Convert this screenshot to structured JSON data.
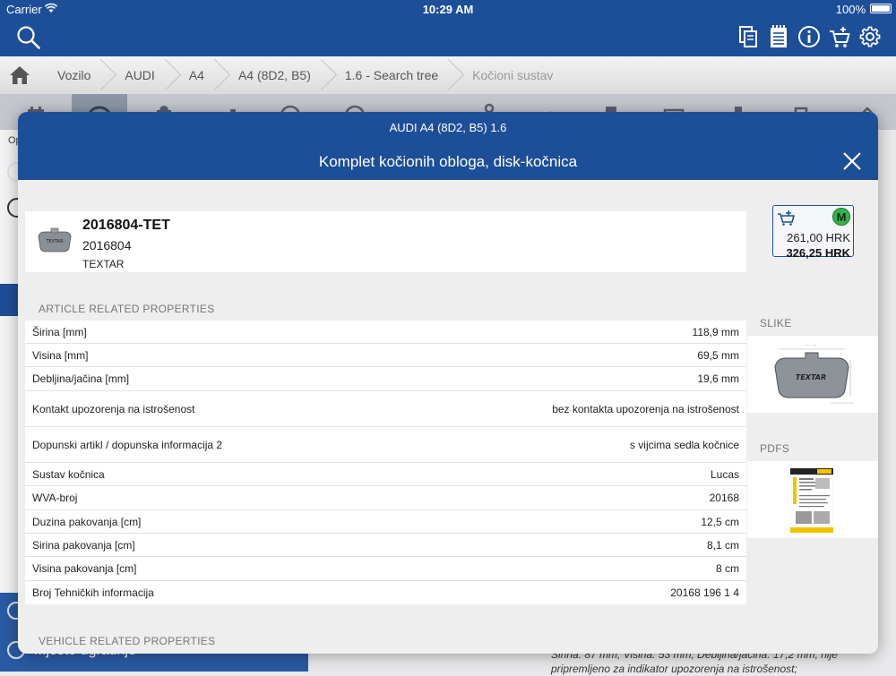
{
  "status_bar": {
    "carrier": "Carrier",
    "time": "10:29 AM",
    "battery": "100%"
  },
  "breadcrumb": {
    "items": [
      "Vozilo",
      "AUDI",
      "A4",
      "A4 (8D2, B5)",
      "1.6 - Search tree",
      "Kočioni sustav"
    ]
  },
  "background": {
    "left_fragment": "Op",
    "bottom_left_label": "Mjesto ugradnje",
    "bottom_text": "Širina: 87 mm; Visina: 53 mm; Debljina/jačina: 17,2 mm; nije pripremljeno za indikator upozorenja na istrošenost;"
  },
  "modal": {
    "vehicle": "AUDI A4 (8D2, B5) 1.6",
    "title": "Komplet kočionih obloga, disk-kočnica"
  },
  "article": {
    "code": "2016804-TET",
    "number": "2016804",
    "brand": "TEXTAR"
  },
  "price": {
    "badge": "M",
    "net": "261,00 HRK",
    "gross": "326,25 HRK"
  },
  "sections": {
    "article_props": "ARTICLE RELATED PROPERTIES",
    "vehicle_props": "VEHICLE RELATED PROPERTIES",
    "images": "SLIKE",
    "pdfs": "PDFS"
  },
  "properties": [
    {
      "label": "Širina [mm]",
      "value": "118,9 mm"
    },
    {
      "label": "Visina [mm]",
      "value": "69,5 mm"
    },
    {
      "label": "Debljina/jačina [mm]",
      "value": "19,6 mm"
    },
    {
      "label": "Kontakt upozorenja na istrošenost",
      "value": "bez kontakta upozorenja na istrošenost"
    },
    {
      "label": "Dopunski artikl / dopunska informacija 2",
      "value": "s vijcima sedla kočnice"
    },
    {
      "label": "Sustav kočnica",
      "value": "Lucas"
    },
    {
      "label": "WVA-broj",
      "value": "20168"
    },
    {
      "label": "Duzina pakovanja [cm]",
      "value": "12,5 cm"
    },
    {
      "label": "Sirina pakovanja [cm]",
      "value": "8,1 cm"
    },
    {
      "label": "Visina pakovanja [cm]",
      "value": "8 cm"
    },
    {
      "label": "Broj Tehničkih informacija",
      "value": "20168 196  1 4"
    }
  ],
  "pad_image_text": "TEXTAR",
  "colors": {
    "brand_blue": "#1d4f99",
    "badge_green": "#36b34a"
  },
  "icons": {
    "top_bar": [
      "search-icon",
      "documents-icon",
      "notepad-icon",
      "info-icon",
      "cart-icon",
      "settings-icon"
    ],
    "home": "home-icon",
    "close": "close-icon",
    "cart_add": "cart-add-icon"
  }
}
